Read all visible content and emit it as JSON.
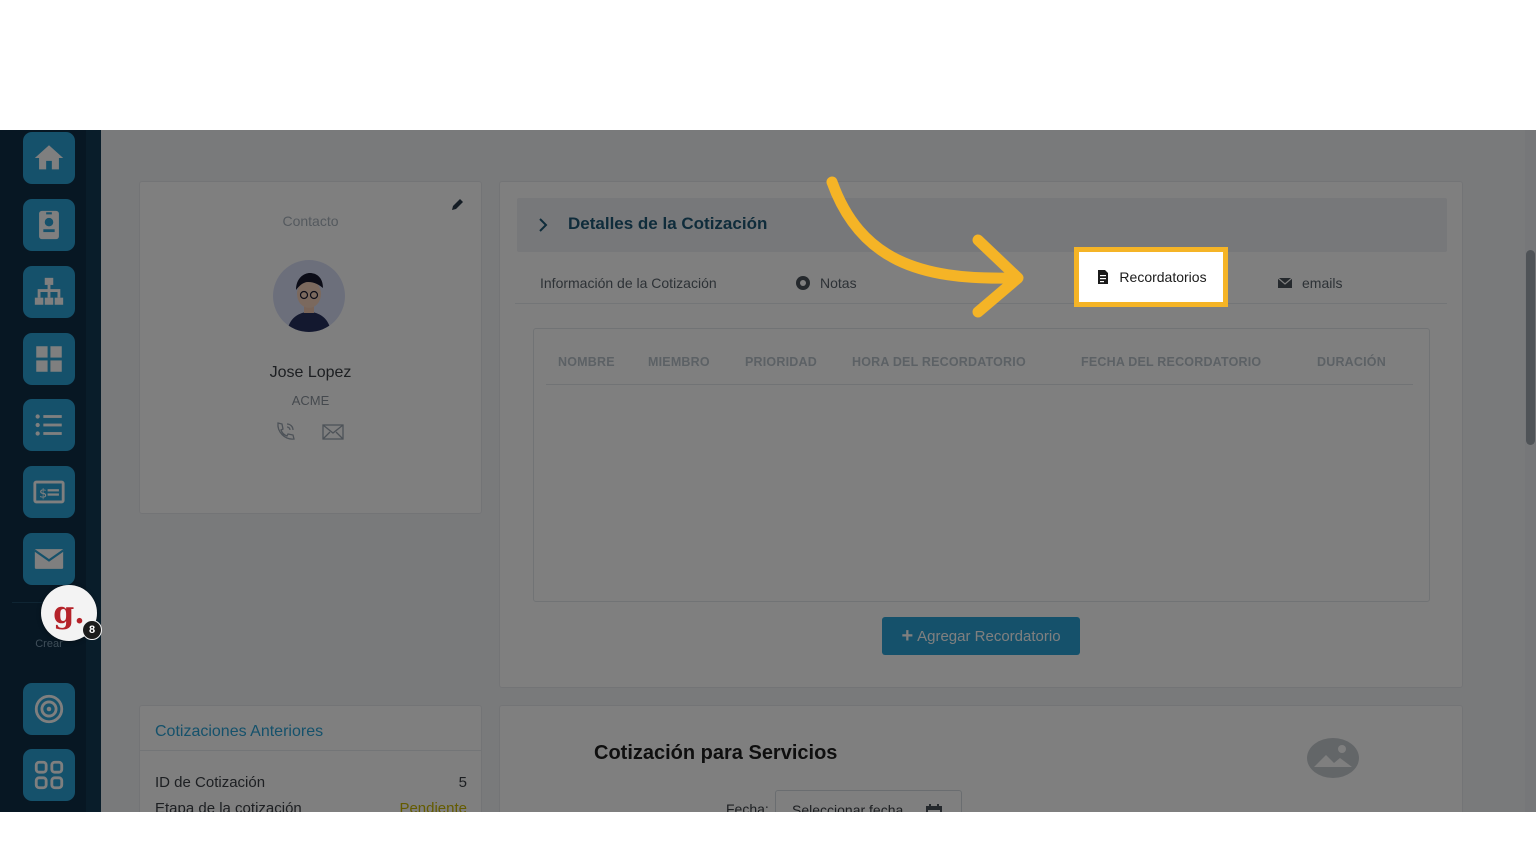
{
  "sidebar": {
    "items": [
      {
        "icon": "home-icon"
      },
      {
        "icon": "contact-card-icon"
      },
      {
        "icon": "org-chart-icon"
      },
      {
        "icon": "dashboard-grid-icon"
      },
      {
        "icon": "list-icon"
      },
      {
        "icon": "quote-money-icon"
      },
      {
        "icon": "mail-icon"
      }
    ],
    "crear_label": "Crear",
    "create_items": [
      {
        "icon": "target-icon"
      },
      {
        "icon": "apps-icon"
      }
    ],
    "badge_letter": "g.",
    "badge_count": "8"
  },
  "contact": {
    "title": "Contacto",
    "name": "Jose Lopez",
    "company": "ACME"
  },
  "previous": {
    "title": "Cotizaciones Anteriores",
    "rows": [
      {
        "label": "ID de Cotización",
        "value": "5"
      },
      {
        "label": "Etapa de la cotización",
        "value": "Pendiente"
      }
    ]
  },
  "details": {
    "title": "Detalles de la Cotización",
    "tabs": {
      "info": "Información de la Cotización",
      "notas": "Notas",
      "recordatorios": "Recordatorios",
      "emails": "emails"
    },
    "columns": [
      "NOMBRE",
      "MIEMBRO",
      "PRIORIDAD",
      "HORA DEL RECORDATORIO",
      "FECHA DEL RECORDATORIO",
      "DURACIÓN"
    ],
    "add_button": "Agregar Recordatorio"
  },
  "service": {
    "title": "Cotización para Servicios",
    "fecha_label": "Fecha:",
    "fecha_placeholder": "Seleccionar fecha"
  },
  "colors": {
    "accent": "#2aa3d6",
    "sidebar": "#123a55",
    "highlight": "#f5b426"
  }
}
